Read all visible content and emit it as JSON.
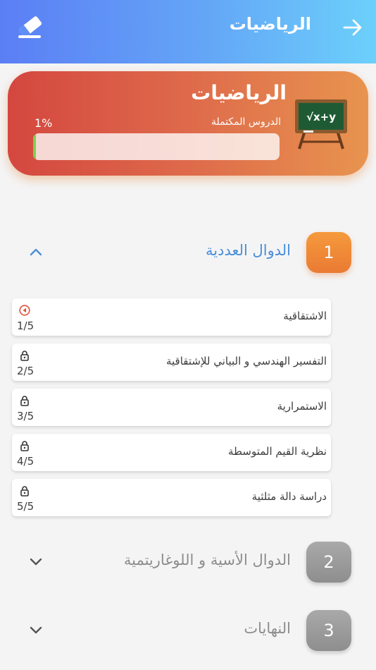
{
  "header": {
    "title": "الرياضيات",
    "back_icon": "arrow-right-icon",
    "action_icon": "eraser-icon"
  },
  "hero": {
    "title": "الرياضيات",
    "subtitle": "الدروس المكتملة",
    "progress_label": "1%",
    "progress_value": 0.01,
    "board_text": "√x+y",
    "board_icon": "chalkboard-icon",
    "colors": {
      "start": "#d4473f",
      "end": "#e8944f",
      "progress": "#7cd24a"
    }
  },
  "sections": [
    {
      "number": "1",
      "title": "الدوال العددية",
      "expanded": true,
      "lessons": [
        {
          "title": "الاشتقاقية",
          "count": "1/5",
          "icon": "play-icon"
        },
        {
          "title": "التفسير الهندسي و البياني للإشتقاقية",
          "count": "2/5",
          "icon": "lock-icon"
        },
        {
          "title": "الاستمرارية",
          "count": "3/5",
          "icon": "lock-icon"
        },
        {
          "title": "نظرية القيم المتوسطة",
          "count": "4/5",
          "icon": "lock-icon"
        },
        {
          "title": "دراسة دالة مثلثية",
          "count": "5/5",
          "icon": "lock-icon"
        }
      ]
    },
    {
      "number": "2",
      "title": "الدوال الأسية و اللوغاريتمية",
      "expanded": false
    },
    {
      "number": "3",
      "title": "النهايات",
      "expanded": false
    }
  ]
}
